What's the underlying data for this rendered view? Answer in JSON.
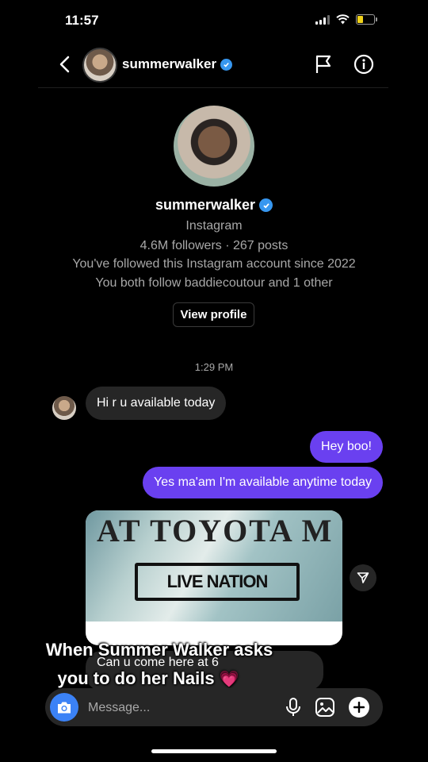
{
  "status_bar": {
    "time": "11:57"
  },
  "header": {
    "username": "summerwalker",
    "icons": [
      "chevron-left-icon",
      "flag-icon",
      "info-icon",
      "verified-icon"
    ]
  },
  "profile": {
    "username": "summerwalker",
    "subtitle": "Instagram",
    "stats": "4.6M followers · 267 posts",
    "followed_since": "You've followed this Instagram account since 2022",
    "mutuals": "You both follow baddiecoutour and 1 other",
    "view_profile_label": "View profile"
  },
  "thread": {
    "timestamp": "1:29 PM",
    "messages": [
      {
        "from": "them",
        "text": "Hi r u available today"
      },
      {
        "from": "me",
        "text": "Hey boo!"
      },
      {
        "from": "me",
        "text": "Yes ma'am I'm available anytime today"
      }
    ],
    "media": {
      "line1": "AT TOYOTA M",
      "line2": "LIVE NATION"
    },
    "reply_preview": "Can u come here at 6"
  },
  "overlay_caption": {
    "line1": "When Summer Walker asks",
    "line2": "you to do her Nails",
    "emoji": "💗"
  },
  "composer": {
    "placeholder": "Message...",
    "icons": [
      "camera-icon",
      "microphone-icon",
      "gallery-icon",
      "plus-icon"
    ]
  },
  "colors": {
    "background": "#000000",
    "outgoing_bubble": "#6a40f0",
    "incoming_bubble": "#262626",
    "accent_blue": "#3797f0",
    "camera_button": "#3b82f6"
  }
}
